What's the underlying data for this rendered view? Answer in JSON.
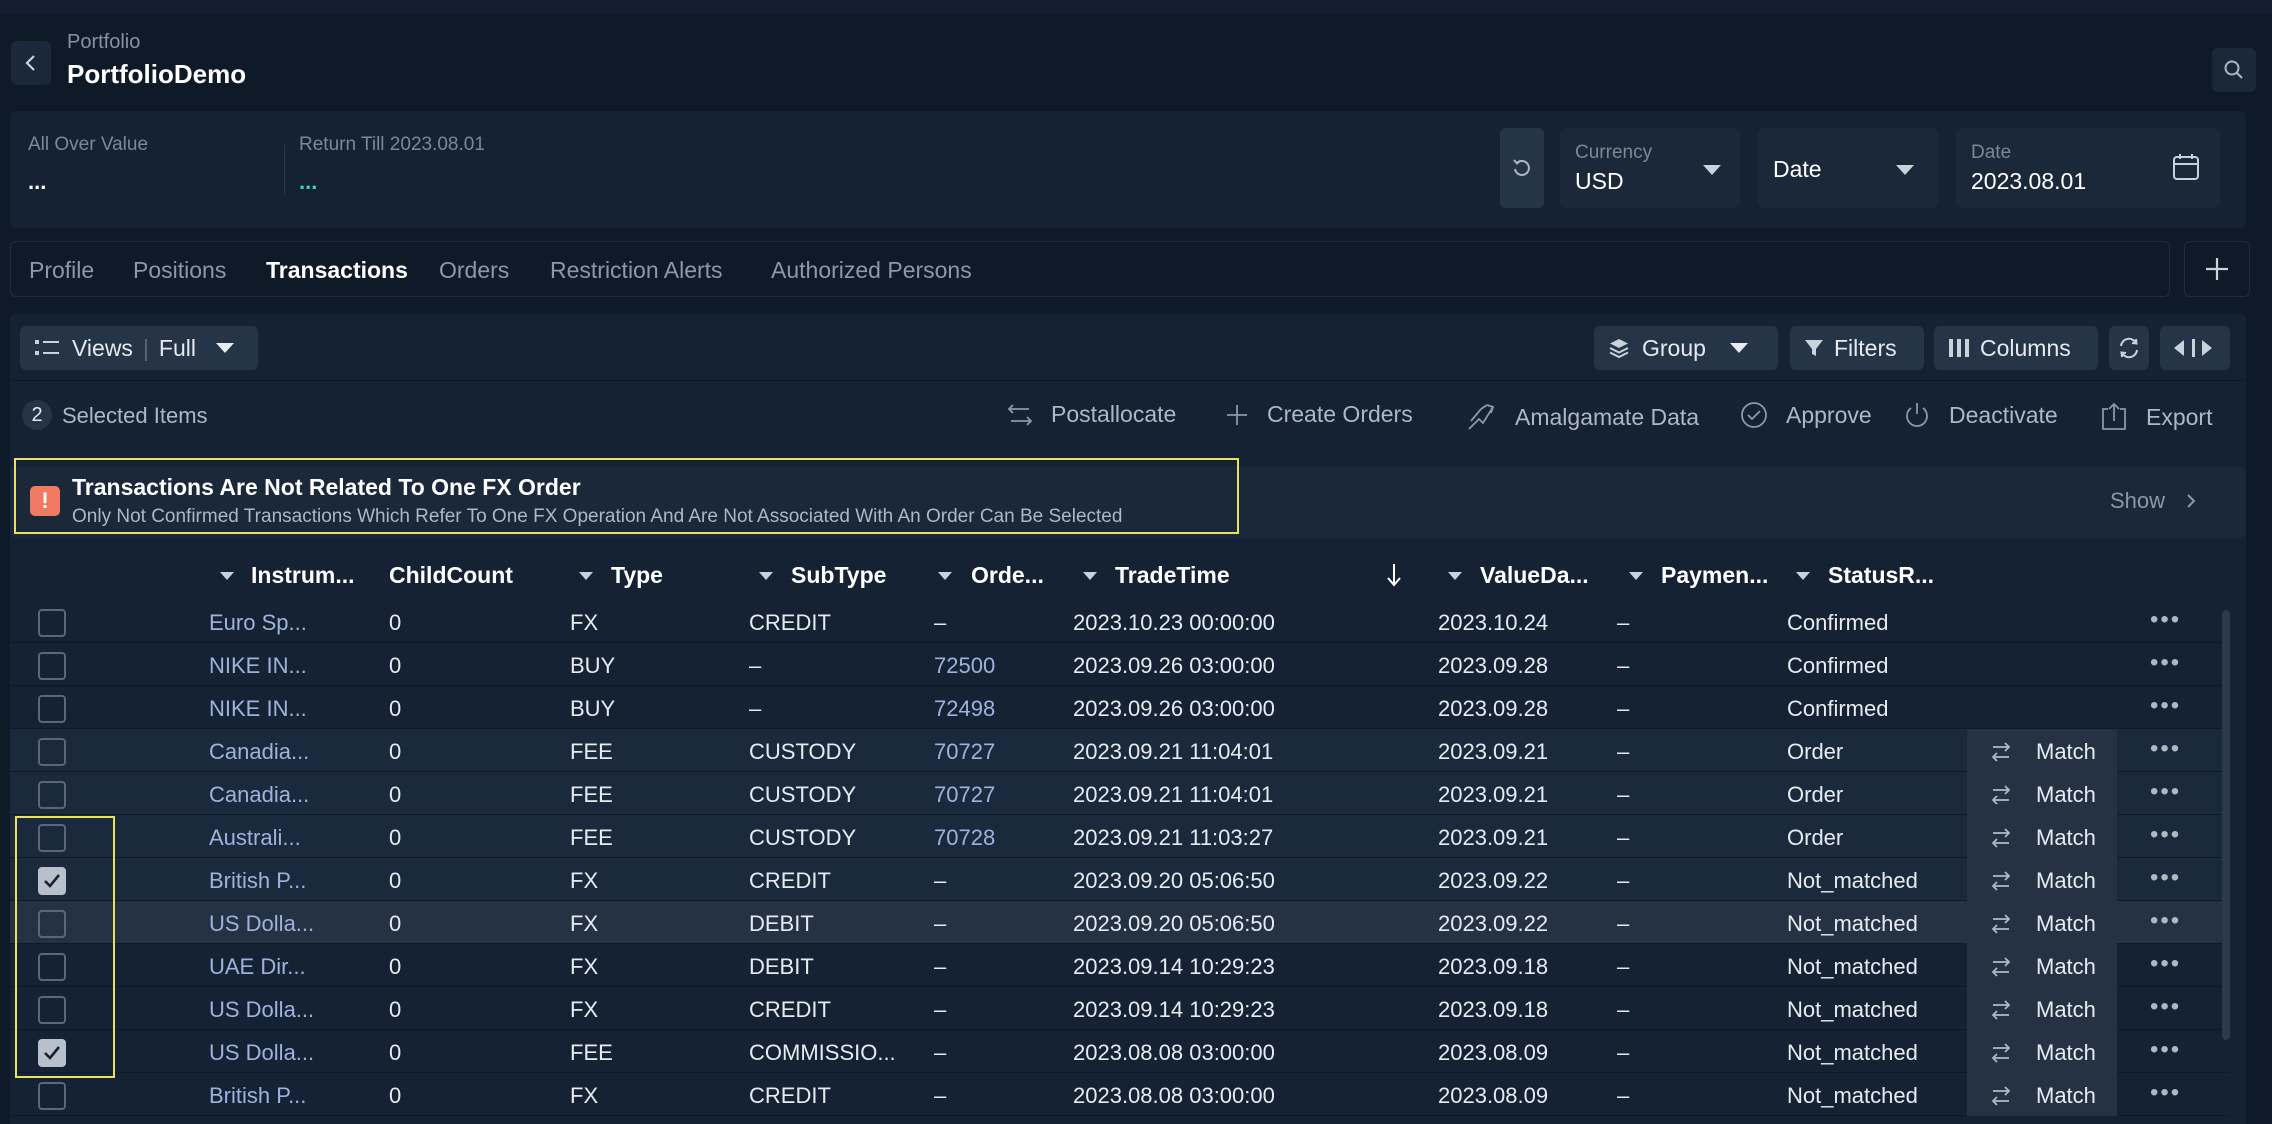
{
  "header": {
    "breadcrumb": "Portfolio",
    "title": "PortfolioDemo"
  },
  "summary": {
    "all_over_value_label": "All Over Value",
    "all_over_value": "...",
    "return_label": "Return Till 2023.08.01",
    "return_value": "...",
    "currency_label": "Currency",
    "currency_value": "USD",
    "date_mode": "Date",
    "date_label": "Date",
    "date_value": "2023.08.01"
  },
  "tabs": [
    "Profile",
    "Positions",
    "Transactions",
    "Orders",
    "Restriction Alerts",
    "Authorized Persons"
  ],
  "active_tab": "Transactions",
  "toolbar": {
    "views_label": "Views",
    "views_value": "Full",
    "group_label": "Group",
    "filters_label": "Filters",
    "columns_label": "Columns"
  },
  "selection": {
    "count": "2",
    "label": "Selected Items"
  },
  "actions": [
    "Postallocate",
    "Create Orders",
    "Amalgamate Data",
    "Approve",
    "Deactivate",
    "Export"
  ],
  "alert": {
    "icon": "!",
    "title": "Transactions Are Not Related To One FX Order",
    "subtitle": "Only Not Confirmed Transactions Which Refer To One FX Operation And Are Not Associated With An Order Can Be Selected",
    "show_label": "Show"
  },
  "columns": [
    "Instrum...",
    "ChildCount",
    "Type",
    "SubType",
    "Orde...",
    "TradeTime",
    "ValueDa...",
    "Paymen...",
    "StatusR..."
  ],
  "match_label": "Match",
  "rows": [
    {
      "instrument": "Euro Sp...",
      "child": "0",
      "type": "FX",
      "subtype": "CREDIT",
      "order": "–",
      "trade": "2023.10.23 00:00:00",
      "value": "2023.10.24",
      "payment": "–",
      "status": "Confirmed",
      "checked": false,
      "match": false
    },
    {
      "instrument": "NIKE IN...",
      "child": "0",
      "type": "BUY",
      "subtype": "–",
      "order": "72500",
      "trade": "2023.09.26 03:00:00",
      "value": "2023.09.28",
      "payment": "–",
      "status": "Confirmed",
      "checked": false,
      "match": false
    },
    {
      "instrument": "NIKE IN...",
      "child": "0",
      "type": "BUY",
      "subtype": "–",
      "order": "72498",
      "trade": "2023.09.26 03:00:00",
      "value": "2023.09.28",
      "payment": "–",
      "status": "Confirmed",
      "checked": false,
      "match": false
    },
    {
      "instrument": "Canadia...",
      "child": "0",
      "type": "FEE",
      "subtype": "CUSTODY",
      "order": "70727",
      "trade": "2023.09.21 11:04:01",
      "value": "2023.09.21",
      "payment": "–",
      "status": "Order",
      "checked": false,
      "match": true
    },
    {
      "instrument": "Canadia...",
      "child": "0",
      "type": "FEE",
      "subtype": "CUSTODY",
      "order": "70727",
      "trade": "2023.09.21 11:04:01",
      "value": "2023.09.21",
      "payment": "–",
      "status": "Order",
      "checked": false,
      "match": true
    },
    {
      "instrument": "Australi...",
      "child": "0",
      "type": "FEE",
      "subtype": "CUSTODY",
      "order": "70728",
      "trade": "2023.09.21 11:03:27",
      "value": "2023.09.21",
      "payment": "–",
      "status": "Order",
      "checked": false,
      "match": true
    },
    {
      "instrument": "British P...",
      "child": "0",
      "type": "FX",
      "subtype": "CREDIT",
      "order": "–",
      "trade": "2023.09.20 05:06:50",
      "value": "2023.09.22",
      "payment": "–",
      "status": "Not_matched",
      "checked": true,
      "match": true
    },
    {
      "instrument": "US Dolla...",
      "child": "0",
      "type": "FX",
      "subtype": "DEBIT",
      "order": "–",
      "trade": "2023.09.20 05:06:50",
      "value": "2023.09.22",
      "payment": "–",
      "status": "Not_matched",
      "checked": false,
      "match": true
    },
    {
      "instrument": "UAE Dir...",
      "child": "0",
      "type": "FX",
      "subtype": "DEBIT",
      "order": "–",
      "trade": "2023.09.14 10:29:23",
      "value": "2023.09.18",
      "payment": "–",
      "status": "Not_matched",
      "checked": false,
      "match": true
    },
    {
      "instrument": "US Dolla...",
      "child": "0",
      "type": "FX",
      "subtype": "CREDIT",
      "order": "–",
      "trade": "2023.09.14 10:29:23",
      "value": "2023.09.18",
      "payment": "–",
      "status": "Not_matched",
      "checked": false,
      "match": true
    },
    {
      "instrument": "US Dolla...",
      "child": "0",
      "type": "FEE",
      "subtype": "COMMISSIO...",
      "order": "–",
      "trade": "2023.08.08 03:00:00",
      "value": "2023.08.09",
      "payment": "–",
      "status": "Not_matched",
      "checked": true,
      "match": true
    },
    {
      "instrument": "British P...",
      "child": "0",
      "type": "FX",
      "subtype": "CREDIT",
      "order": "–",
      "trade": "2023.08.08 03:00:00",
      "value": "2023.08.09",
      "payment": "–",
      "status": "Not_matched",
      "checked": false,
      "match": true
    }
  ]
}
